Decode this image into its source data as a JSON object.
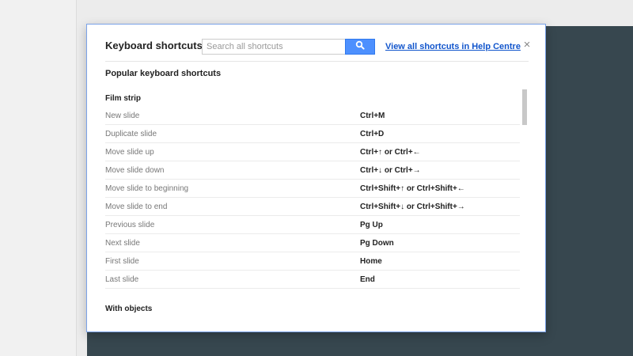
{
  "dialog": {
    "title": "Keyboard shortcuts",
    "search": {
      "placeholder": "Search all shortcuts",
      "value": ""
    },
    "help_link": "View all shortcuts in Help Centre",
    "close_symbol": "×",
    "section_heading": "Popular keyboard shortcuts",
    "groups": [
      {
        "title": "Film strip",
        "shortcuts": [
          {
            "action": "New slide",
            "keys": "Ctrl+M"
          },
          {
            "action": "Duplicate slide",
            "keys": "Ctrl+D"
          },
          {
            "action": "Move slide up",
            "keys": "Ctrl+↑ or Ctrl+←"
          },
          {
            "action": "Move slide down",
            "keys": "Ctrl+↓ or Ctrl+→"
          },
          {
            "action": "Move slide to beginning",
            "keys": "Ctrl+Shift+↑ or Ctrl+Shift+←"
          },
          {
            "action": "Move slide to end",
            "keys": "Ctrl+Shift+↓ or Ctrl+Shift+→"
          },
          {
            "action": "Previous slide",
            "keys": "Pg Up"
          },
          {
            "action": "Next slide",
            "keys": "Pg Down"
          },
          {
            "action": "First slide",
            "keys": "Home"
          },
          {
            "action": "Last slide",
            "keys": "End"
          }
        ]
      },
      {
        "title": "With objects",
        "shortcuts": []
      }
    ]
  },
  "icons": {
    "search": "search-icon",
    "close": "close-icon"
  },
  "colors": {
    "search_button": "#4d90fe",
    "link": "#1155cc",
    "backdrop": "#37474f",
    "dialog_border": "#7aa2e8"
  }
}
